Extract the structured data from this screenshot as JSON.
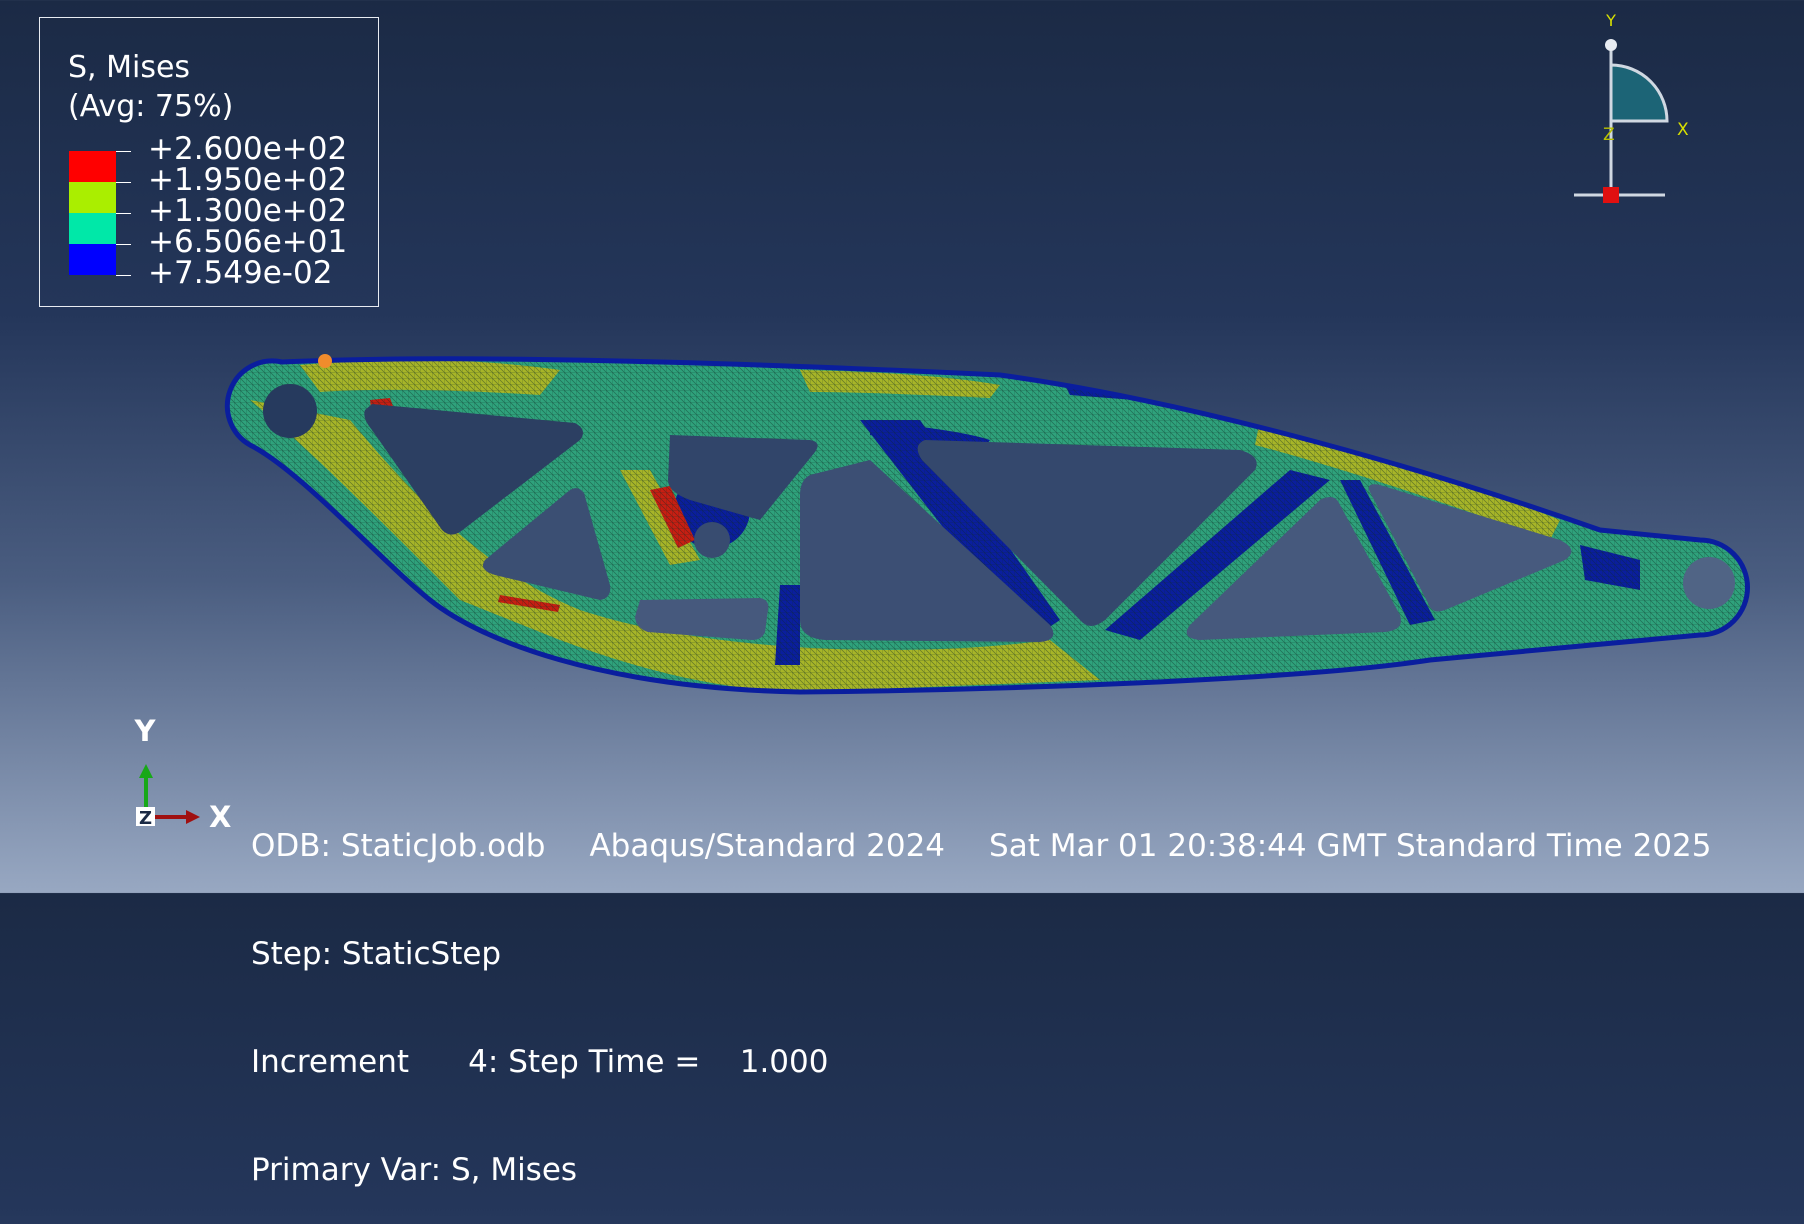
{
  "legend": {
    "title": "S, Mises",
    "subtitle": "(Avg: 75%)",
    "entries": [
      {
        "label": "+2.600e+02",
        "color": "#ff0000"
      },
      {
        "label": "+1.950e+02",
        "color": "#aaee00"
      },
      {
        "label": "+1.300e+02",
        "color": "#00e8a8"
      },
      {
        "label": "+6.506e+01",
        "color": "#0000ff"
      },
      {
        "label": "+7.549e-02"
      }
    ]
  },
  "view_triad": {
    "y": "Y",
    "x": "X",
    "z": "Z"
  },
  "global_axes": {
    "y": "Y",
    "x": "X",
    "z": "Z"
  },
  "info": {
    "odb": "ODB: StaticJob.odb",
    "solver": "Abaqus/Standard 2024",
    "datetime": "Sat Mar 01 20:38:44 GMT Standard Time 2025",
    "step": "Step: StaticStep",
    "increment": "Increment      4: Step Time =    1.000",
    "primary_var": "Primary Var: S, Mises"
  },
  "colors": {
    "background_top": "#1b2a45",
    "background_bottom": "#98a8c2",
    "mesh_green": "#2fa27c",
    "mesh_yellow": "#a7b528",
    "mesh_blue": "#0a1e9e",
    "mesh_red": "#c81e12"
  }
}
